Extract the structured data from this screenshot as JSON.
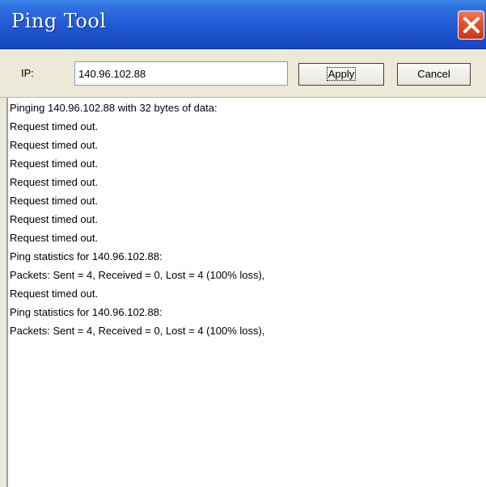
{
  "window": {
    "title": "Ping Tool",
    "close_icon": "close-icon"
  },
  "toolbar": {
    "ip_label": "IP:",
    "ip_value": "140.96.102.88",
    "apply_label": "Apply",
    "cancel_label": "Cancel"
  },
  "output": {
    "lines": [
      "Pinging 140.96.102.88 with 32 bytes of data:",
      "Request timed out.",
      "Request timed out.",
      "Request timed out.",
      "Request timed out.",
      "Request timed out.",
      "Request timed out.",
      "Request timed out.",
      "Ping statistics for 140.96.102.88:",
      "Packets: Sent = 4, Received = 0, Lost = 4 (100% loss),",
      "Request timed out.",
      "Ping statistics for 140.96.102.88:",
      "Packets: Sent = 4, Received = 0, Lost = 4 (100% loss),"
    ]
  },
  "colors": {
    "titlebar": "#1f58d2",
    "close_button": "#e3502a",
    "dialog_background": "#ece9d8"
  }
}
